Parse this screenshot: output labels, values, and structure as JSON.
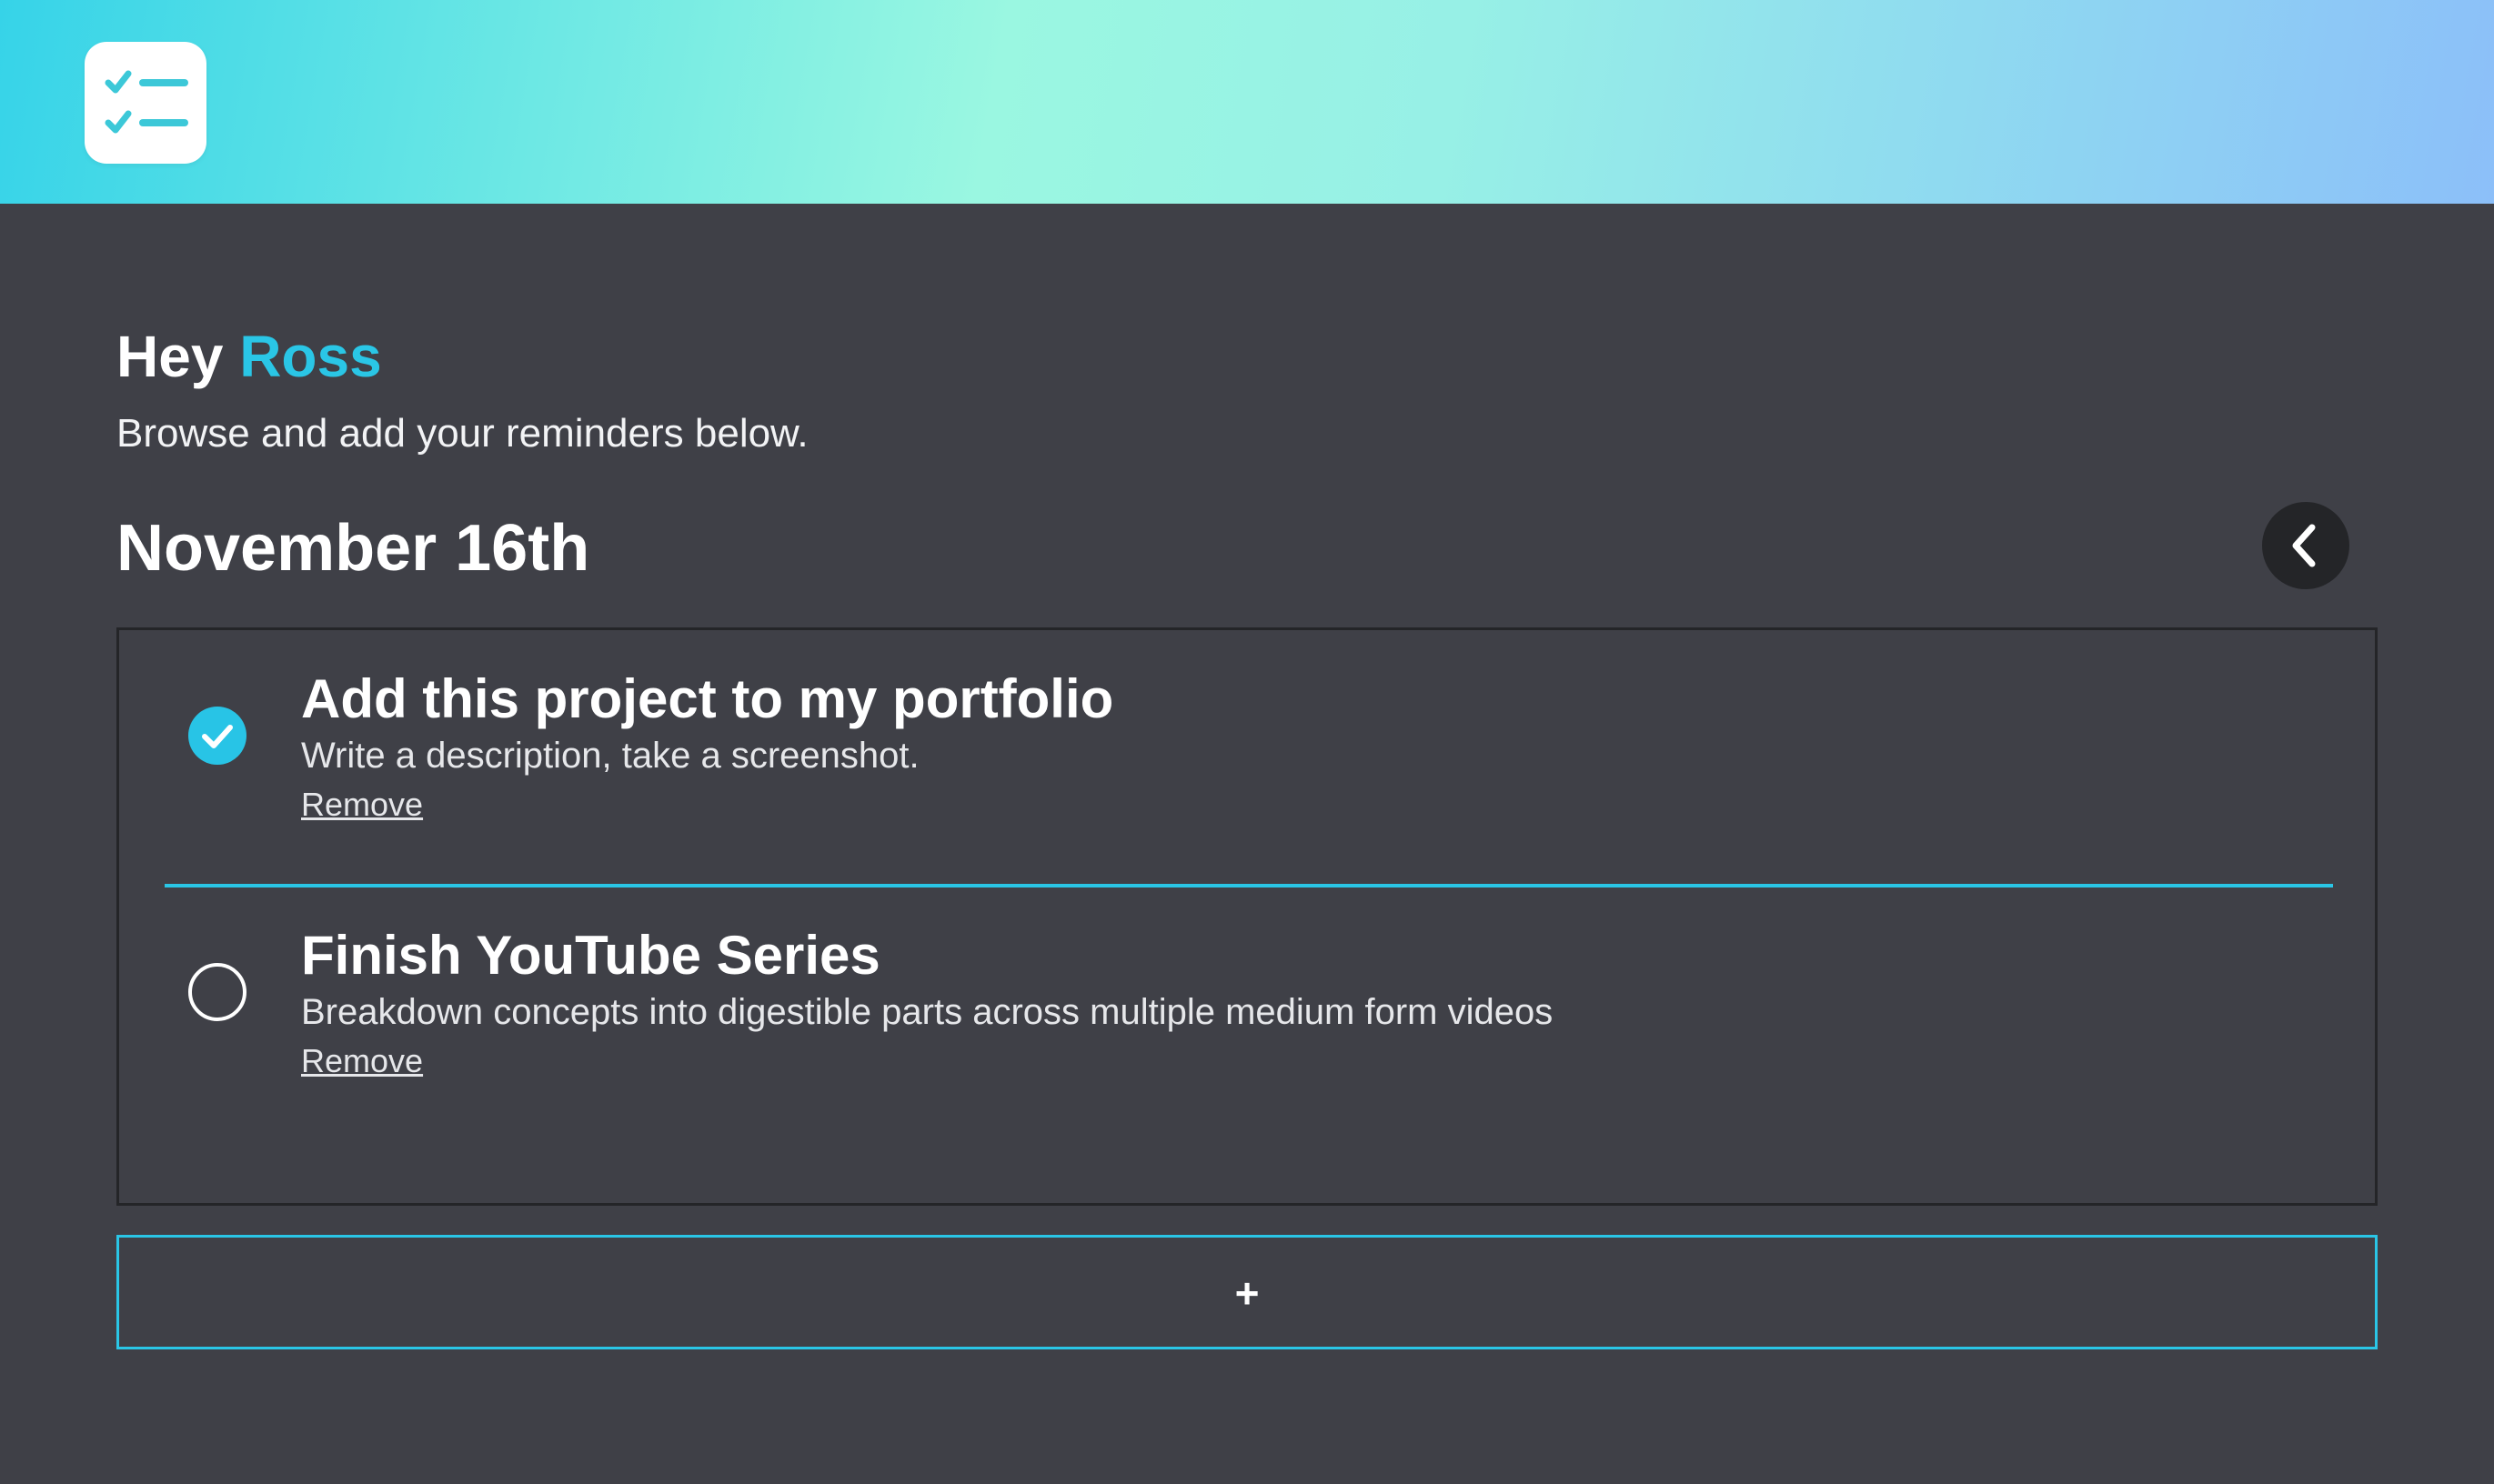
{
  "header": {
    "logo_icon": "checklist-icon",
    "gradient_colors": [
      "#36d3e8",
      "#9af7e1",
      "#8cbff9"
    ]
  },
  "greeting": {
    "prefix": "Hey ",
    "name": "Ross",
    "subtitle": "Browse and add your reminders below."
  },
  "date": {
    "title": "November 16th",
    "back_icon": "chevron-left-icon"
  },
  "reminders": [
    {
      "title": "Add this project to my portfolio",
      "description": "Write a description, take a screenshot.",
      "remove_label": "Remove",
      "completed": true
    },
    {
      "title": "Finish YouTube Series",
      "description": "Breakdown concepts into digestible parts across multiple medium form videos",
      "remove_label": "Remove",
      "completed": false
    }
  ],
  "add_button": {
    "label": "+"
  },
  "colors": {
    "accent": "#2ac6e6",
    "background": "#3f4047",
    "panel_border": "#242528"
  }
}
